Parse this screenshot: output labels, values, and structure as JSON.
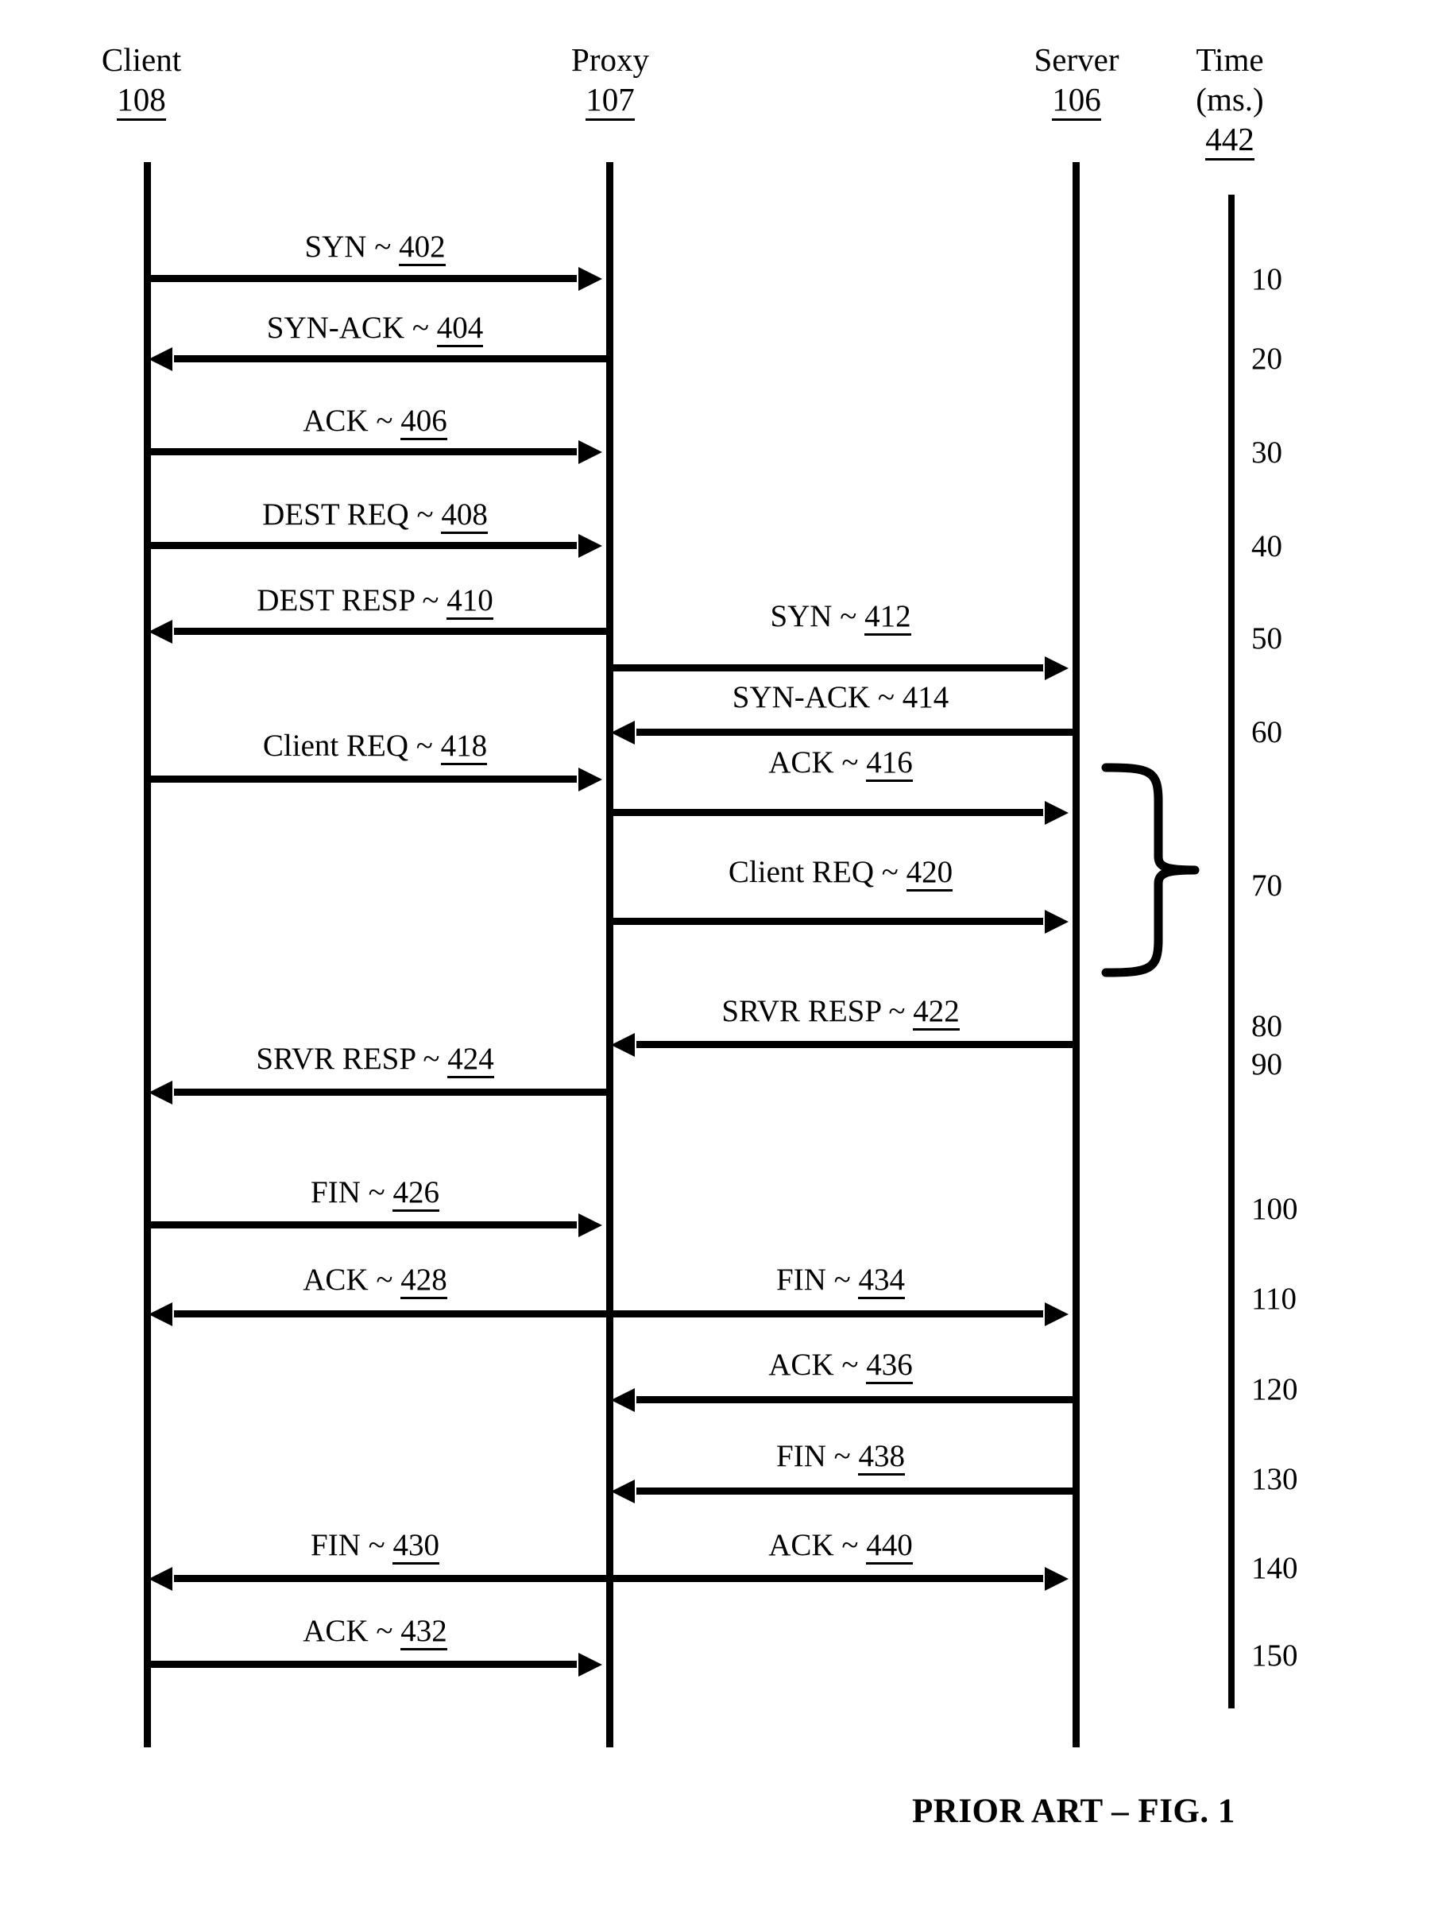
{
  "figure": {
    "caption": "PRIOR ART – FIG. 1"
  },
  "columns": [
    {
      "name": "Client",
      "ref": "108"
    },
    {
      "name": "Proxy",
      "ref": "107"
    },
    {
      "name": "Server",
      "ref": "106"
    },
    {
      "name": "Time",
      "unit": "(ms.)",
      "ref": "442"
    }
  ],
  "messages": [
    {
      "id": "402",
      "text": "SYN ~ ",
      "from": "client",
      "to": "proxy",
      "direction": "right",
      "underlined": true
    },
    {
      "id": "404",
      "text": "SYN-ACK ~ ",
      "from": "proxy",
      "to": "client",
      "direction": "left",
      "underlined": true
    },
    {
      "id": "406",
      "text": "ACK ~ ",
      "from": "client",
      "to": "proxy",
      "direction": "right",
      "underlined": true
    },
    {
      "id": "408",
      "text": "DEST REQ  ~ ",
      "from": "client",
      "to": "proxy",
      "direction": "right",
      "underlined": true
    },
    {
      "id": "410",
      "text": "DEST RESP ~ ",
      "from": "proxy",
      "to": "client",
      "direction": "left",
      "underlined": true
    },
    {
      "id": "412",
      "text": "SYN ~ ",
      "from": "proxy",
      "to": "server",
      "direction": "right",
      "underlined": true
    },
    {
      "id": "414",
      "text": "SYN-ACK ~ ",
      "from": "server",
      "to": "proxy",
      "direction": "left",
      "underlined": false
    },
    {
      "id": "418",
      "text": "Client REQ ~ ",
      "from": "client",
      "to": "proxy",
      "direction": "right",
      "underlined": true
    },
    {
      "id": "416",
      "text": "ACK ~ ",
      "from": "proxy",
      "to": "server",
      "direction": "right",
      "underlined": true
    },
    {
      "id": "420",
      "text": "Client REQ ~ ",
      "from": "proxy",
      "to": "server",
      "direction": "right",
      "underlined": true
    },
    {
      "id": "422",
      "text": "SRVR RESP ~ ",
      "from": "server",
      "to": "proxy",
      "direction": "left",
      "underlined": true
    },
    {
      "id": "424",
      "text": "SRVR RESP ~ ",
      "from": "proxy",
      "to": "client",
      "direction": "left",
      "underlined": true
    },
    {
      "id": "426",
      "text": "FIN ~ ",
      "from": "client",
      "to": "proxy",
      "direction": "right",
      "underlined": true
    },
    {
      "id": "428",
      "text": "ACK ~ ",
      "from": "proxy",
      "to": "client",
      "direction": "left",
      "underlined": true
    },
    {
      "id": "434",
      "text": "FIN ~ ",
      "from": "proxy",
      "to": "server",
      "direction": "right",
      "underlined": true
    },
    {
      "id": "436",
      "text": "ACK ~ ",
      "from": "server",
      "to": "proxy",
      "direction": "left",
      "underlined": true
    },
    {
      "id": "438",
      "text": "FIN ~ ",
      "from": "server",
      "to": "proxy",
      "direction": "left",
      "underlined": true
    },
    {
      "id": "430",
      "text": "FIN ~ ",
      "from": "proxy",
      "to": "client",
      "direction": "left",
      "underlined": true
    },
    {
      "id": "440",
      "text": "ACK ~ ",
      "from": "proxy",
      "to": "server",
      "direction": "right",
      "underlined": true
    },
    {
      "id": "432",
      "text": "ACK ~ ",
      "from": "client",
      "to": "proxy",
      "direction": "right",
      "underlined": true
    }
  ],
  "time_ticks": [
    "10",
    "20",
    "30",
    "40",
    "50",
    "60",
    "70",
    "80",
    "90",
    "100",
    "110",
    "120",
    "130",
    "140",
    "150"
  ],
  "chart_data": {
    "type": "table",
    "title": "PRIOR ART – FIG. 1",
    "xlabel": "",
    "ylabel": "Time (ms.)",
    "ylim": [
      0,
      160
    ],
    "lifelines": [
      "Client 108",
      "Proxy 107",
      "Server 106"
    ],
    "categories": [
      "402",
      "404",
      "406",
      "408",
      "410",
      "412",
      "414",
      "418",
      "416",
      "420",
      "422",
      "424",
      "426",
      "428",
      "434",
      "436",
      "438",
      "430",
      "440",
      "432"
    ],
    "values": [
      10,
      20,
      30,
      40,
      50,
      52,
      60,
      64,
      66,
      74,
      80,
      90,
      100,
      110,
      110,
      120,
      130,
      140,
      140,
      150
    ]
  }
}
